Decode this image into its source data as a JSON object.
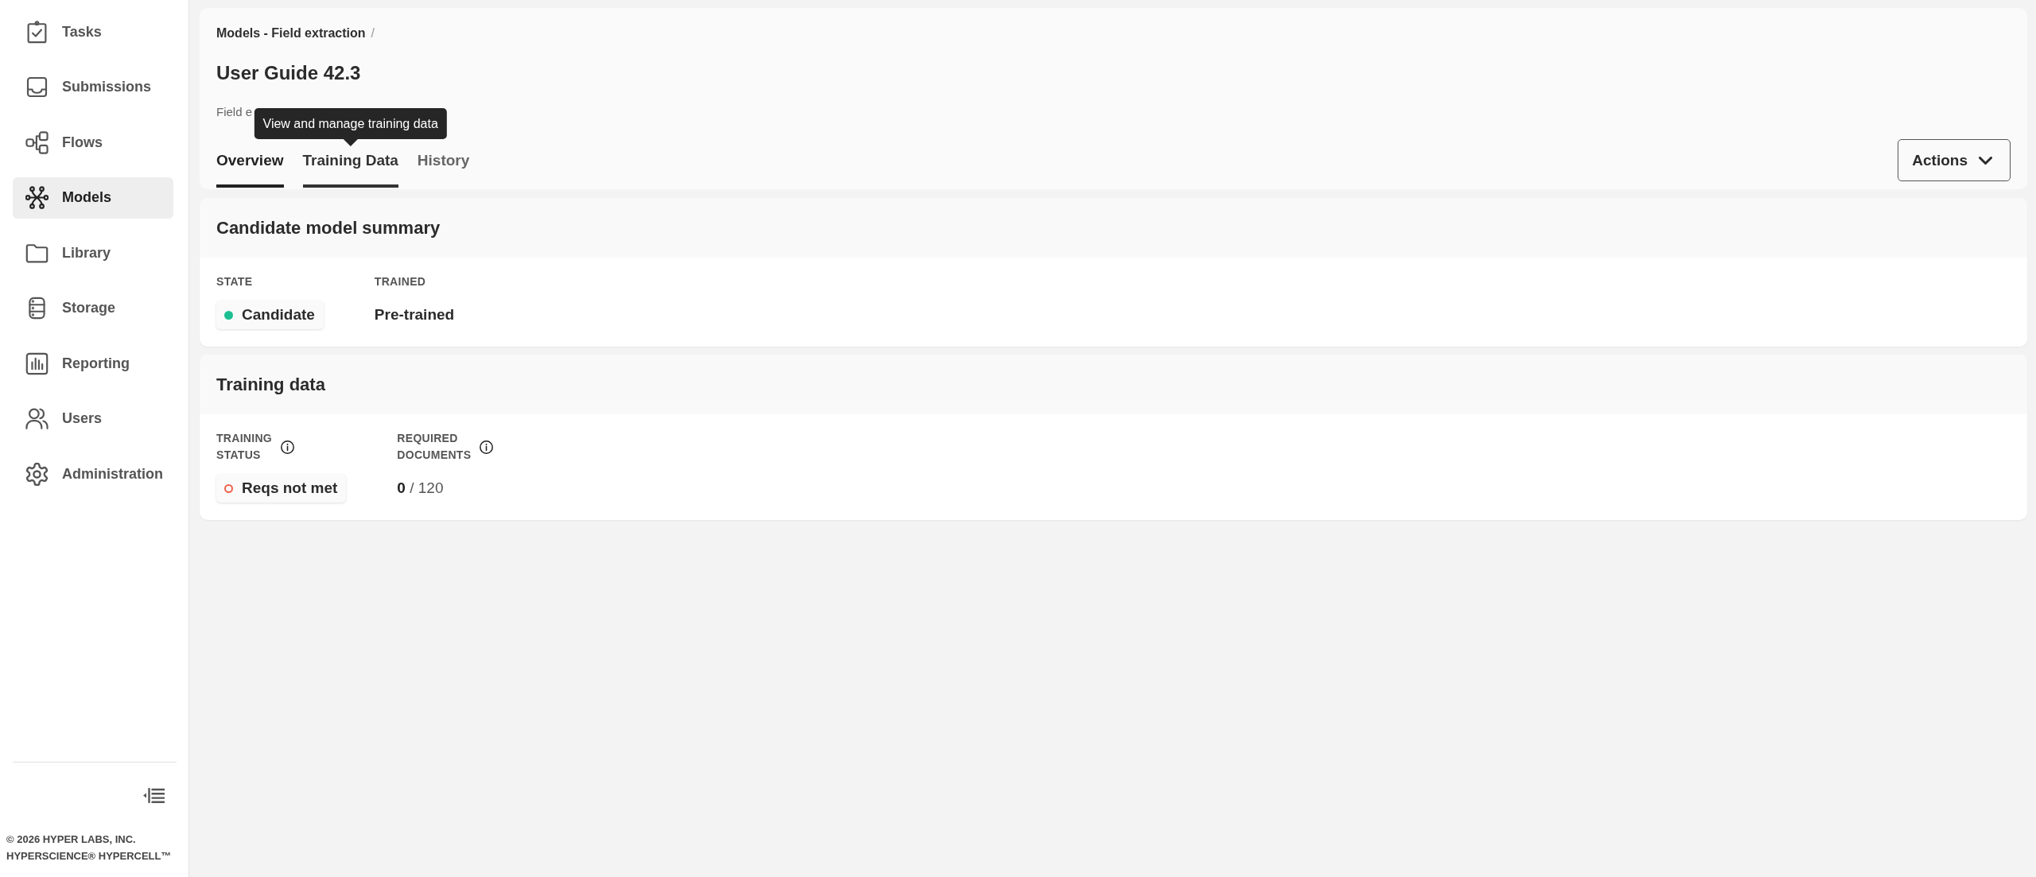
{
  "sidebar": {
    "items": [
      {
        "label": "Tasks",
        "selected": false
      },
      {
        "label": "Submissions",
        "selected": false
      },
      {
        "label": "Flows",
        "selected": false
      },
      {
        "label": "Models",
        "selected": true
      },
      {
        "label": "Library",
        "selected": false
      },
      {
        "label": "Storage",
        "selected": false
      },
      {
        "label": "Reporting",
        "selected": false
      },
      {
        "label": "Users",
        "selected": false
      },
      {
        "label": "Administration",
        "selected": false
      }
    ],
    "footer_lines": [
      "© 2026 HYPER LABS, INC.",
      "HYPERSCIENCE® HYPERCELL™"
    ]
  },
  "header": {
    "breadcrumb": [
      {
        "label": "Models - Field extraction",
        "separator": "/"
      }
    ],
    "title": "User Guide 42.3",
    "subtitle": "Field e",
    "tabs": [
      {
        "label": "Overview",
        "selected": true,
        "hovered": false
      },
      {
        "label": "Training Data",
        "selected": false,
        "hovered": true,
        "tooltip": "View and manage training data"
      },
      {
        "label": "History",
        "selected": false,
        "hovered": false
      }
    ],
    "actions_button": {
      "label": "Actions"
    }
  },
  "cards": [
    {
      "title": "Candidate model summary",
      "fields": [
        {
          "label": "STATE",
          "info": false,
          "kind": "chip",
          "value": "Candidate",
          "color": "#1dbf92",
          "filled": true
        },
        {
          "label": "TRAINED",
          "info": false,
          "kind": "strong",
          "value": "Pre-trained"
        }
      ]
    },
    {
      "title": "Training data",
      "fields": [
        {
          "label": "TRAINING STATUS",
          "info": true,
          "kind": "chip",
          "value": "Reqs not met",
          "color": "#f0604d",
          "filled": false
        },
        {
          "label": "REQUIRED DOCUMENTS",
          "info": true,
          "kind": "ratio",
          "value": "**0** / 120"
        }
      ]
    }
  ]
}
